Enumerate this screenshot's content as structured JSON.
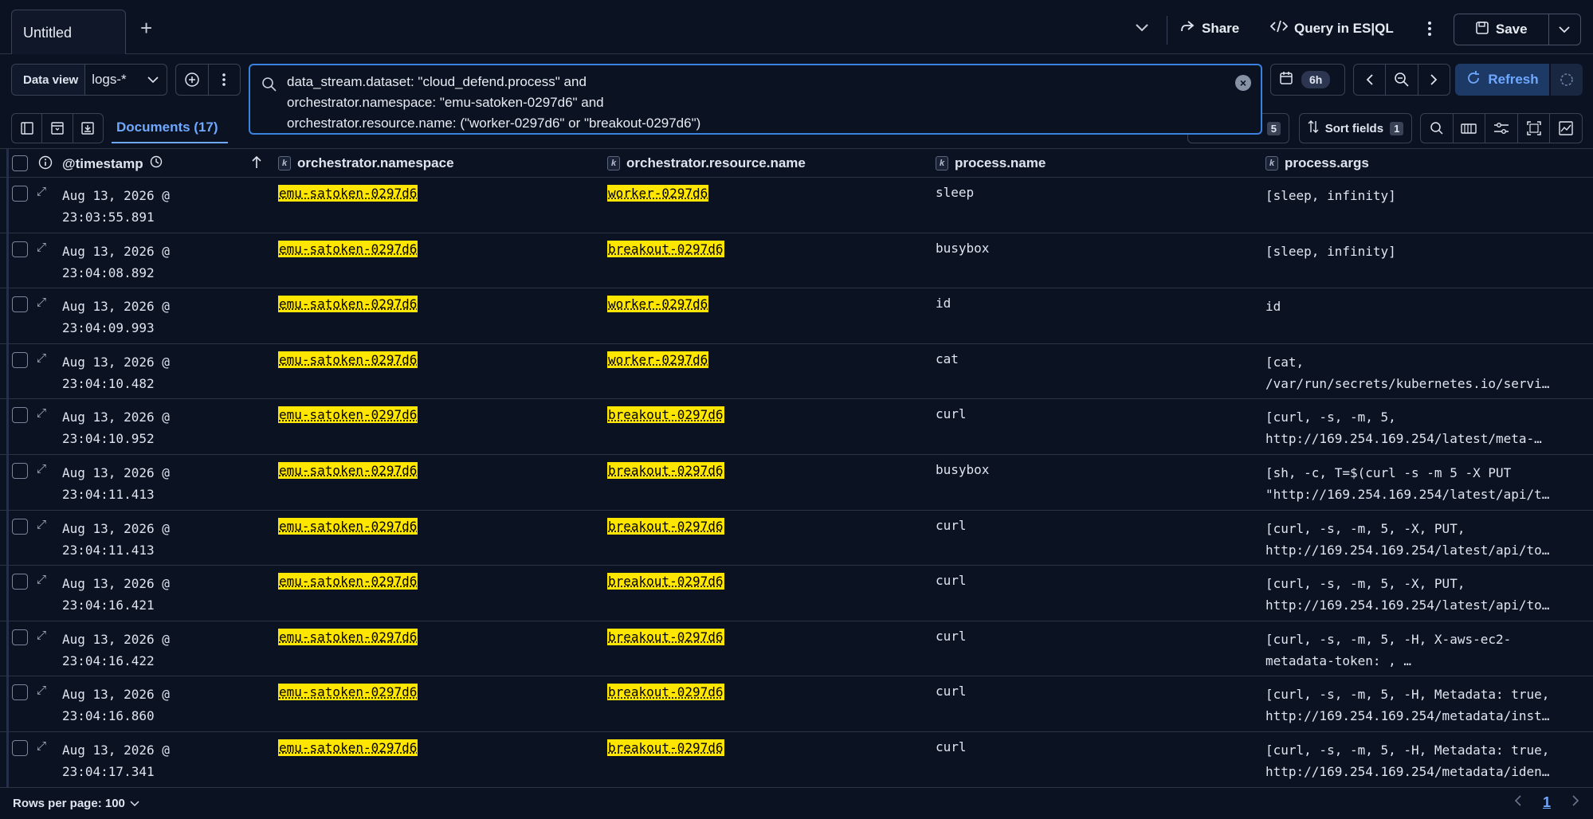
{
  "tabs": {
    "active": "Untitled",
    "add": "+"
  },
  "header": {
    "share": "Share",
    "query_in": "Query in ES|QL",
    "save": "Save"
  },
  "dataview": {
    "label": "Data view",
    "value": "logs-*"
  },
  "query": {
    "text": "data_stream.dataset: \"cloud_defend.process\" and\norchestrator.namespace: \"emu-satoken-0297d6\" and\norchestrator.resource.name: (\"worker-0297d6\" or \"breakout-0297d6\")"
  },
  "time": {
    "quick": "6h"
  },
  "refresh": {
    "label": "Refresh"
  },
  "toolbar": {
    "documents_tab": "Documents (17)",
    "columns_count": "5",
    "sort_label": "Sort fields",
    "sort_count": "1"
  },
  "columns": {
    "timestamp": "@timestamp",
    "namespace": "orchestrator.namespace",
    "resource": "orchestrator.resource.name",
    "process_name": "process.name",
    "process_args": "process.args",
    "keyword_badge": "k"
  },
  "rows": [
    {
      "ts": "Aug 13, 2026 @\n23:03:55.891",
      "ns": "emu-satoken-0297d6",
      "rn": "worker-0297d6",
      "pn": "sleep",
      "pa": "[sleep, infinity]"
    },
    {
      "ts": "Aug 13, 2026 @\n23:04:08.892",
      "ns": "emu-satoken-0297d6",
      "rn": "breakout-0297d6",
      "pn": "busybox",
      "pa": "[sleep, infinity]"
    },
    {
      "ts": "Aug 13, 2026 @\n23:04:09.993",
      "ns": "emu-satoken-0297d6",
      "rn": "worker-0297d6",
      "pn": "id",
      "pa": "id"
    },
    {
      "ts": "Aug 13, 2026 @\n23:04:10.482",
      "ns": "emu-satoken-0297d6",
      "rn": "worker-0297d6",
      "pn": "cat",
      "pa": "[cat,\n/var/run/secrets/kubernetes.io/servi…"
    },
    {
      "ts": "Aug 13, 2026 @\n23:04:10.952",
      "ns": "emu-satoken-0297d6",
      "rn": "breakout-0297d6",
      "pn": "curl",
      "pa": "[curl, -s, -m, 5,\nhttp://169.254.169.254/latest/meta-…"
    },
    {
      "ts": "Aug 13, 2026 @\n23:04:11.413",
      "ns": "emu-satoken-0297d6",
      "rn": "breakout-0297d6",
      "pn": "busybox",
      "pa": "[sh, -c, T=$(curl -s -m 5 -X PUT\n\"http://169.254.169.254/latest/api/t…"
    },
    {
      "ts": "Aug 13, 2026 @\n23:04:11.413",
      "ns": "emu-satoken-0297d6",
      "rn": "breakout-0297d6",
      "pn": "curl",
      "pa": "[curl, -s, -m, 5, -X, PUT,\nhttp://169.254.169.254/latest/api/to…"
    },
    {
      "ts": "Aug 13, 2026 @\n23:04:16.421",
      "ns": "emu-satoken-0297d6",
      "rn": "breakout-0297d6",
      "pn": "curl",
      "pa": "[curl, -s, -m, 5, -X, PUT,\nhttp://169.254.169.254/latest/api/to…"
    },
    {
      "ts": "Aug 13, 2026 @\n23:04:16.422",
      "ns": "emu-satoken-0297d6",
      "rn": "breakout-0297d6",
      "pn": "curl",
      "pa": "[curl, -s, -m, 5, -H, X-aws-ec2-\nmetadata-token: , …"
    },
    {
      "ts": "Aug 13, 2026 @\n23:04:16.860",
      "ns": "emu-satoken-0297d6",
      "rn": "breakout-0297d6",
      "pn": "curl",
      "pa": "[curl, -s, -m, 5, -H, Metadata: true,\nhttp://169.254.169.254/metadata/inst…"
    },
    {
      "ts": "Aug 13, 2026 @\n23:04:17.341",
      "ns": "emu-satoken-0297d6",
      "rn": "breakout-0297d6",
      "pn": "curl",
      "pa": "[curl, -s, -m, 5, -H, Metadata: true,\nhttp://169.254.169.254/metadata/iden…"
    }
  ],
  "footer": {
    "rows_per_page": "Rows per page: 100",
    "current_page": "1"
  },
  "colors": {
    "accent": "#6fa8ff",
    "highlight": "#ffe600",
    "background": "#0b1221",
    "focus_border": "#3b82e0"
  }
}
